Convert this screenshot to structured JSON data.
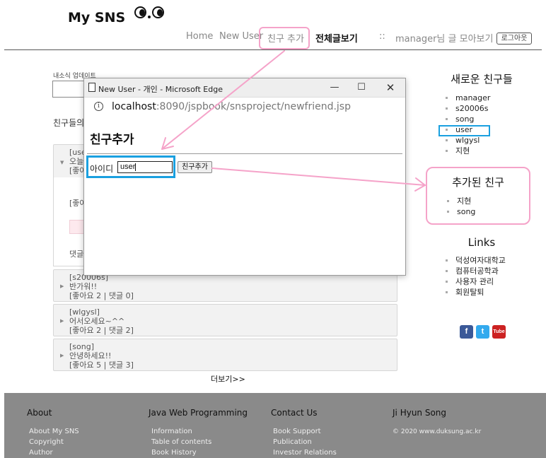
{
  "header": {
    "logo_text": "My SNS",
    "nav": {
      "home": "Home",
      "new_user": "New User",
      "add_friend": "친구 추가",
      "all_posts": "전체글보기",
      "separator": "::",
      "user_posts": "manager님 글 모아보기",
      "logout": "로그아웃"
    }
  },
  "main": {
    "update_label": "내소식 업데이트",
    "friends_title_fragment": "친구들의",
    "expanded_post": {
      "author_fragment": "[use",
      "text_fragment": "오늘",
      "meta_fragment": "[좋아",
      "likes_fragment": "[좋아",
      "comments_fragment": "댓글"
    },
    "posts": [
      {
        "author": "[s20006s]",
        "text": "반가워!!",
        "meta": "[좋아요 2 | 댓글 0]"
      },
      {
        "author": "[wlgysl]",
        "text": "어서오세요~^^",
        "meta": "[좋아요 2 | 댓글 2]"
      },
      {
        "author": "[song]",
        "text": "안녕하세요!!",
        "meta": "[좋아요 5 | 댓글 3]"
      }
    ],
    "more": "더보기>>"
  },
  "sidebar": {
    "new_friends_title": "새로운 친구들",
    "new_friends": [
      "manager",
      "s20006s",
      "song",
      "user",
      "wlgysl",
      "지현"
    ],
    "added_title": "추가된 친구",
    "added_friends": [
      "지현",
      "song"
    ],
    "links_title": "Links",
    "links": [
      "덕성여자대학교",
      "컴퓨터공학과",
      "사용자 관리",
      "회원탈퇴"
    ],
    "social": [
      "f",
      "t",
      "Tube"
    ]
  },
  "popup": {
    "window_title": "New User - 개인 - Microsoft Edge",
    "url_host": "localhost",
    "url_rest": ":8090/jspbook/snsproject/newfriend.jsp",
    "heading": "친구추가",
    "id_label": "아이디",
    "id_value": "user",
    "add_button": "친구추가"
  },
  "footer": {
    "columns": [
      {
        "title": "About",
        "links": [
          "About My SNS",
          "Copyright",
          "Author"
        ]
      },
      {
        "title": "Java Web Programming",
        "links": [
          "Information",
          "Table of contents",
          "Book History"
        ]
      },
      {
        "title": "Contact Us",
        "links": [
          "Book Support",
          "Publication",
          "Investor Relations"
        ]
      },
      {
        "title": "Ji Hyun Song",
        "links": [
          "© 2020 www.duksung.ac.kr"
        ]
      }
    ]
  },
  "colors": {
    "annotation_pink": "#f5a3c9",
    "annotation_blue": "#1aa0e0",
    "footer_bg": "#8a8a8a"
  }
}
